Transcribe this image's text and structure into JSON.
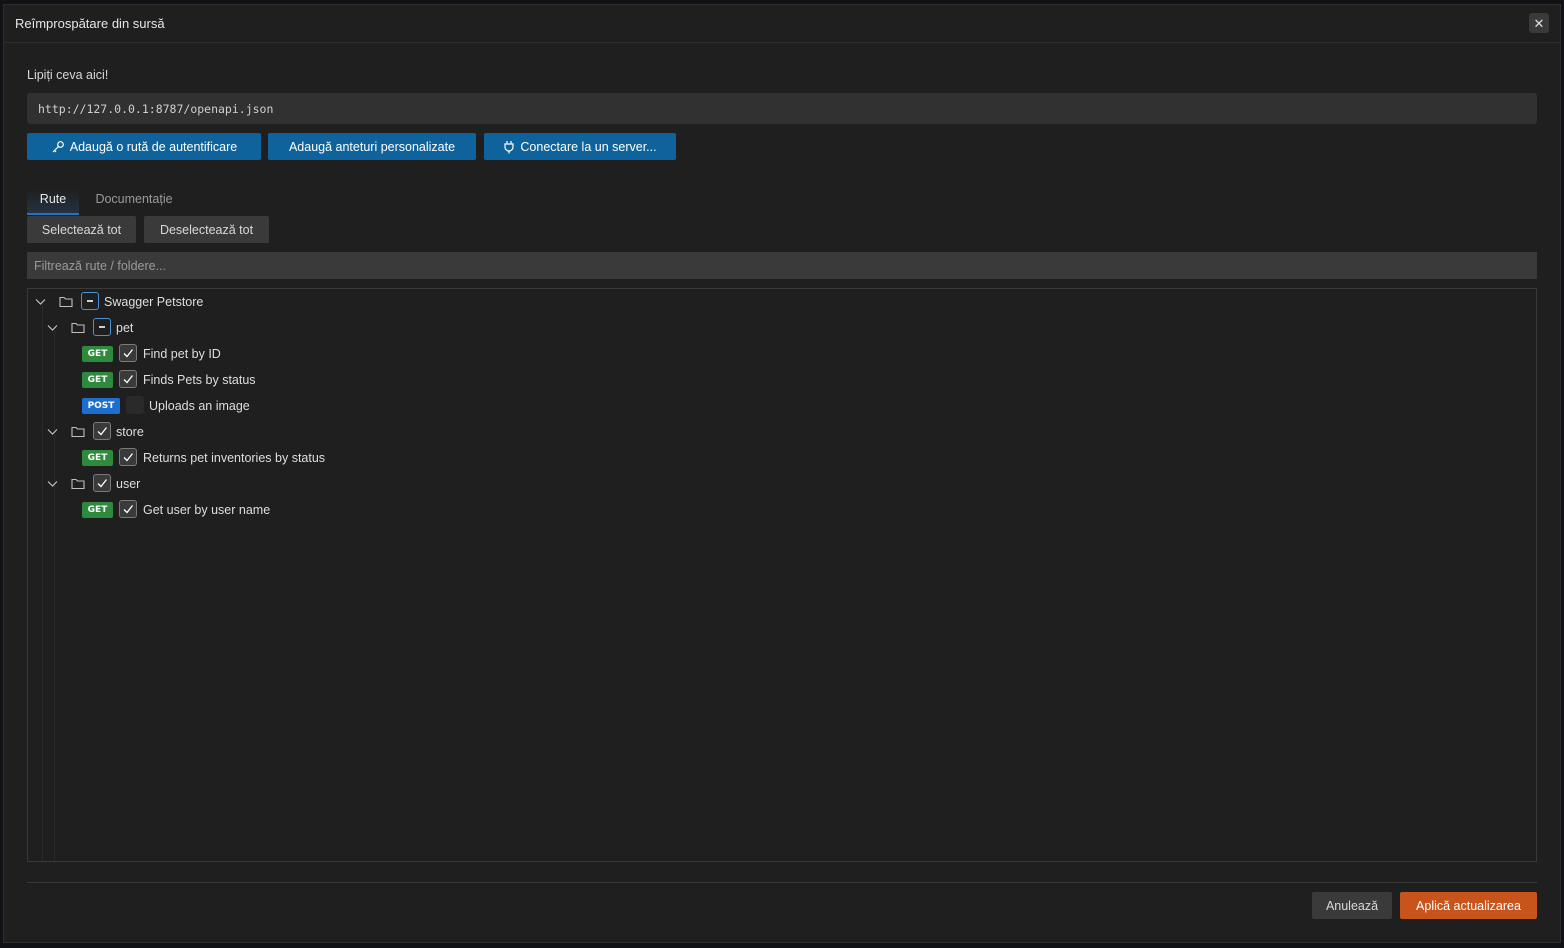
{
  "dialog": {
    "title": "Reîmprospătare din sursă",
    "close_glyph": "✕",
    "paste_label": "Lipiți ceva aici!",
    "url_value": "http://127.0.0.1:8787/openapi.json"
  },
  "actions": {
    "add_auth_route": "Adaugă o rută de autentificare",
    "add_headers": "Adaugă anteturi personalizate",
    "connect_server": "Conectare la un server..."
  },
  "tabs": {
    "routes": "Rute",
    "docs": "Documentație"
  },
  "selection": {
    "select_all": "Selectează tot",
    "deselect_all": "Deselectează tot"
  },
  "filter": {
    "placeholder": "Filtrează rute / foldere..."
  },
  "tree": {
    "root": {
      "label": "Swagger Petstore",
      "state": "partial"
    },
    "folders": [
      {
        "label": "pet",
        "state": "partial",
        "routes": [
          {
            "method": "GET",
            "label": "Find pet by ID",
            "checked": true
          },
          {
            "method": "GET",
            "label": "Finds Pets by status",
            "checked": true
          },
          {
            "method": "POST",
            "label": "Uploads an image",
            "checked": false
          }
        ]
      },
      {
        "label": "store",
        "state": "checked",
        "routes": [
          {
            "method": "GET",
            "label": "Returns pet inventories by status",
            "checked": true
          }
        ]
      },
      {
        "label": "user",
        "state": "checked",
        "routes": [
          {
            "method": "GET",
            "label": "Get user by user name",
            "checked": true
          }
        ]
      }
    ]
  },
  "footer": {
    "cancel": "Anulează",
    "apply": "Aplică actualizarea"
  },
  "icons": {
    "close": "close-icon",
    "key": "key-icon",
    "plug": "plug-icon",
    "chevron": "chevron-down-icon",
    "folder": "folder-icon",
    "check": "check-icon"
  },
  "colors": {
    "primary_button": "#0e639c",
    "apply_button": "#c8541c",
    "get_badge": "#2e8b3d",
    "post_badge": "#1c6fd1",
    "tab_underline": "#1a76c9"
  }
}
